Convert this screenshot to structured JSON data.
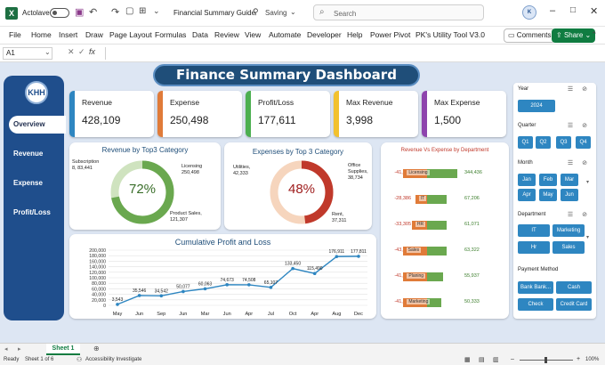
{
  "titlebar": {
    "autosave_label": "Actolave",
    "file_title": "Financial Summary Guide",
    "saving_status": "Saving",
    "search_placeholder": "Search"
  },
  "ribbon": {
    "tabs": [
      "File",
      "Home",
      "Insert",
      "Draw",
      "Page Layout",
      "Formulas",
      "Data",
      "Review",
      "View",
      "Automate",
      "Developer",
      "Help",
      "Power Pivot",
      "PK's Utility Tool V3.0"
    ],
    "comments_label": "Comments",
    "share_label": "Share"
  },
  "formula_bar": {
    "cell_ref": "A1",
    "fx_label": "fx",
    "value": ""
  },
  "dashboard": {
    "title": "Finance Summary Dashboard",
    "logo_text": "KHH",
    "nav": [
      "Overview",
      "Revenue",
      "Expense",
      "Profit/Loss"
    ],
    "kpis": [
      {
        "label": "Revenue",
        "value": "428,109",
        "color": "#2e86c1"
      },
      {
        "label": "Expense",
        "value": "250,498",
        "color": "#e07b39"
      },
      {
        "label": "Profit/Loss",
        "value": "177,611",
        "color": "#4caf50"
      },
      {
        "label": "Max Revenue",
        "value": "3,998",
        "color": "#f2c12e"
      },
      {
        "label": "Max Expense",
        "value": "1,500",
        "color": "#8e44ad"
      }
    ],
    "donut_revenue": {
      "title": "Revenue by Top3 Category",
      "center": "72%",
      "percent": 72,
      "labels": [
        {
          "name": "Subscription",
          "value": "8, 83,441"
        },
        {
          "name": "Licensing",
          "value": "250,498"
        },
        {
          "name": "Product Sales,",
          "value": "121,307"
        }
      ]
    },
    "donut_expense": {
      "title": "Expenses by Top 3 Category",
      "center": "48%",
      "percent": 48,
      "labels": [
        {
          "name": "Utilities,",
          "value": "42,333"
        },
        {
          "name": "Office Supplies,",
          "value": "38,734"
        },
        {
          "name": "Rent,",
          "value": "37,311"
        }
      ]
    },
    "rev_vs_exp": {
      "title": "Revenue Vs Expense by Department",
      "rows": [
        {
          "dept": "Licensing",
          "expense": -41667,
          "revenue": 344436,
          "exp_label": "-41,667",
          "rev_label": "344,436",
          "exp_len": 0.7,
          "rev_len": 0.95
        },
        {
          "dept": "IT",
          "expense": -28386,
          "revenue": 67206,
          "exp_label": "-28,386",
          "rev_label": "67,206",
          "exp_len": 0.35,
          "rev_len": 0.62
        },
        {
          "dept": "HR",
          "expense": -33305,
          "revenue": 61071,
          "exp_label": "-33,305",
          "rev_label": "61,071",
          "exp_len": 0.45,
          "rev_len": 0.6
        },
        {
          "dept": "Sales",
          "expense": -43605,
          "revenue": 63322,
          "exp_label": "-43,605",
          "rev_label": "63,322",
          "exp_len": 0.72,
          "rev_len": 0.6
        },
        {
          "dept": "Planing",
          "expense": -41219,
          "revenue": 55937,
          "exp_label": "-41,219",
          "rev_label": "55,937",
          "exp_len": 0.7,
          "rev_len": 0.5
        },
        {
          "dept": "Marketing",
          "expense": -41372,
          "revenue": 50333,
          "exp_label": "-41,372",
          "rev_label": "50,333",
          "exp_len": 0.7,
          "rev_len": 0.45
        }
      ]
    },
    "slicers": {
      "year": {
        "title": "Year",
        "items": [
          "2024"
        ]
      },
      "quarter": {
        "title": "Quarter",
        "items": [
          "Q1",
          "Q2",
          "Q3",
          "Q4"
        ]
      },
      "month": {
        "title": "Month",
        "items": [
          "Jan",
          "Feb",
          "Mar",
          "Apr",
          "May",
          "Jun"
        ]
      },
      "department": {
        "title": "Department",
        "items": [
          "IT",
          "Marketing",
          "Hr",
          "Sales"
        ]
      },
      "payment": {
        "title": "Payment Method",
        "items": [
          "Bank Bank...",
          "Cash",
          "Check",
          "Credit Card"
        ]
      }
    }
  },
  "chart_data": {
    "type": "line",
    "title": "Cumulative Profit and Loss",
    "categories": [
      "May",
      "Jun",
      "Sep",
      "Jun",
      "Mar",
      "Jun",
      "Apr",
      "Jul",
      "Oct",
      "Apr",
      "Aug",
      "Dec"
    ],
    "values": [
      3543,
      35546,
      34542,
      50077,
      60063,
      74673,
      74508,
      65107,
      133450,
      115490,
      176911,
      177811
    ],
    "value_labels": [
      "3,543",
      "35,546",
      "34,542",
      "50,077",
      "60,063",
      "74,673",
      "74,508",
      "65,107",
      "133,450",
      "115,490",
      "176,911",
      "177,811"
    ],
    "yticks": [
      "0",
      "20,000",
      "40,000",
      "60,000",
      "80,000",
      "100,000",
      "120,000",
      "140,000",
      "160,000",
      "180,000",
      "200,000"
    ],
    "ylim": [
      0,
      200000
    ],
    "grid": true,
    "color": "#2e86c1"
  },
  "sheet_tabs": {
    "active": "Sheet 1"
  },
  "status": {
    "ready": "Ready",
    "sheet_of": "Sheet 1 of 6",
    "accessibility": "Accessibility Investigate",
    "zoom": "100%"
  }
}
